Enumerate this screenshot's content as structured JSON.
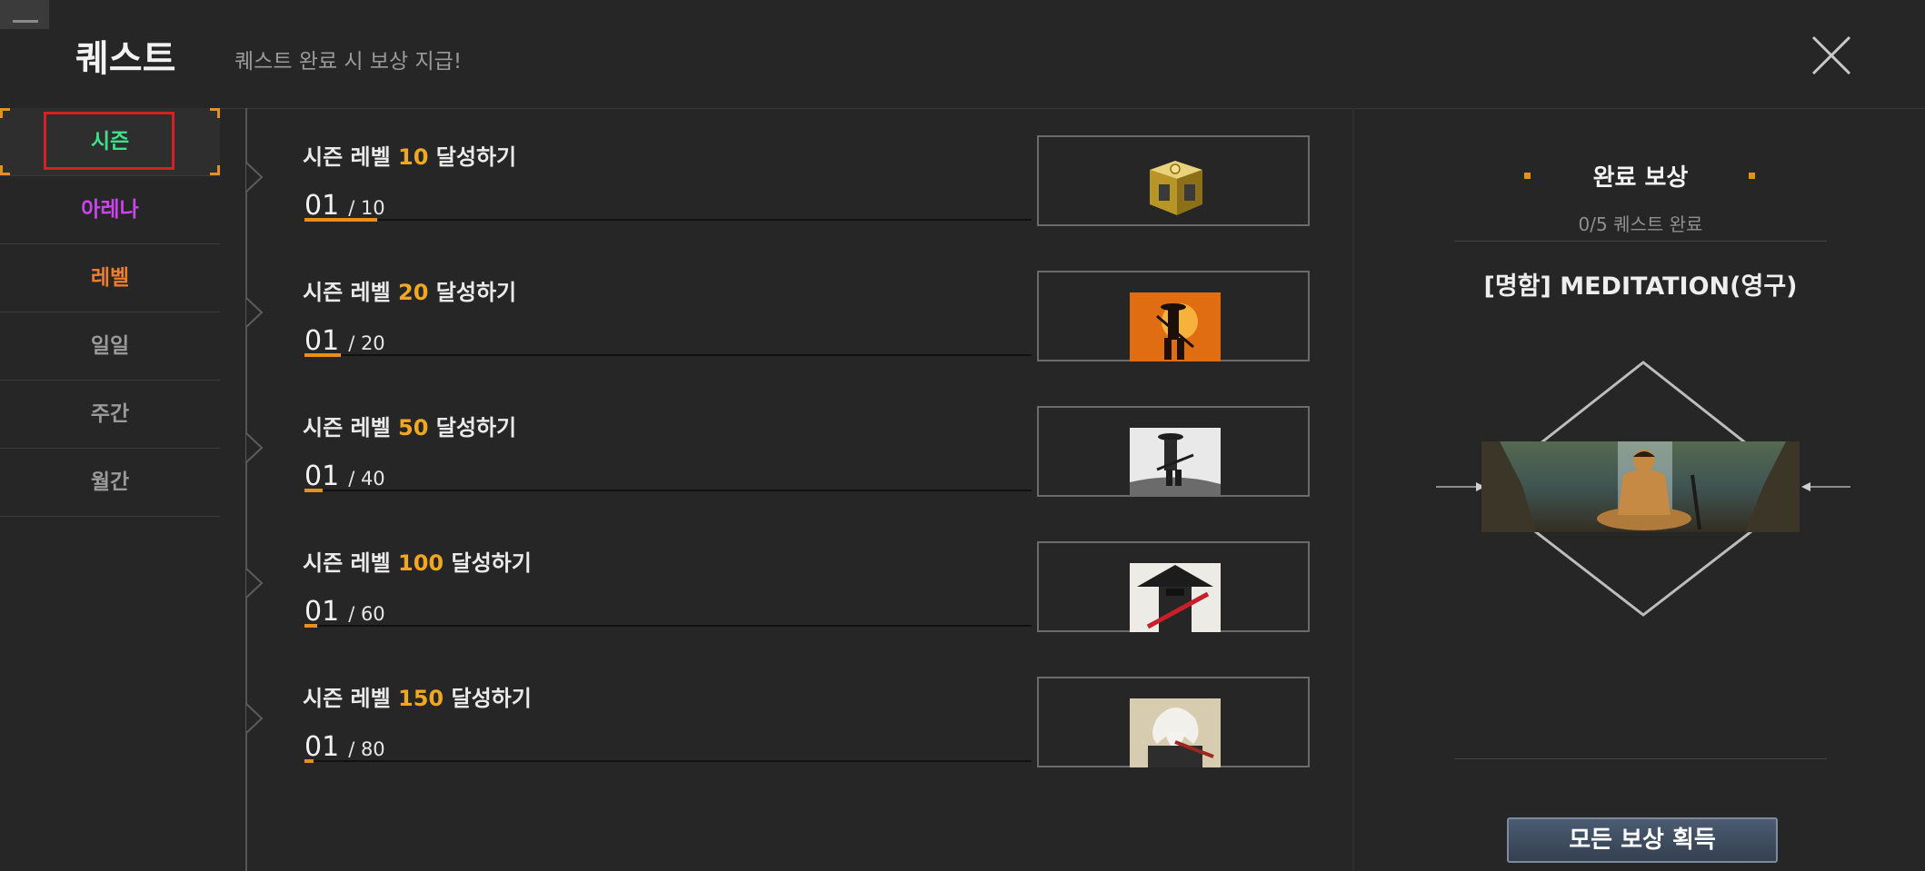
{
  "header": {
    "title": "퀘스트",
    "subtitle": "퀘스트 완료 시 보상 지급!"
  },
  "sidebar": {
    "items": [
      {
        "label": "시즌",
        "color": "#3ee08a",
        "active": true
      },
      {
        "label": "아레나",
        "color": "#cc44ee",
        "active": false
      },
      {
        "label": "레벨",
        "color": "#f07d2a",
        "active": false
      },
      {
        "label": "일일",
        "color": "#9a9a9a",
        "active": false
      },
      {
        "label": "주간",
        "color": "#9a9a9a",
        "active": false
      },
      {
        "label": "월간",
        "color": "#9a9a9a",
        "active": false
      }
    ]
  },
  "quests": [
    {
      "prefix": "시즌 레벨 ",
      "level": "10",
      "suffix": " 달성하기",
      "current": "01",
      "max": "/ 10",
      "progress": 0.1,
      "reward_icon": "gold-chest-icon"
    },
    {
      "prefix": "시즌 레벨 ",
      "level": "20",
      "suffix": " 달성하기",
      "current": "01",
      "max": "/ 20",
      "progress": 0.05,
      "reward_icon": "samurai-sunset-icon"
    },
    {
      "prefix": "시즌 레벨 ",
      "level": "50",
      "suffix": " 달성하기",
      "current": "01",
      "max": "/ 40",
      "progress": 0.025,
      "reward_icon": "samurai-ink-icon"
    },
    {
      "prefix": "시즌 레벨 ",
      "level": "100",
      "suffix": " 달성하기",
      "current": "01",
      "max": "/ 60",
      "progress": 0.017,
      "reward_icon": "ronin-hat-icon"
    },
    {
      "prefix": "시즌 레벨 ",
      "level": "150",
      "suffix": " 달성하기",
      "current": "01",
      "max": "/ 80",
      "progress": 0.0125,
      "reward_icon": "old-sage-icon"
    }
  ],
  "reward_panel": {
    "title": "완료 보상",
    "count": "0/5 퀘스트 완료",
    "item_name": "[명함] MEDITATION(영구)",
    "claim_label": "모든 보상 획득"
  },
  "colors": {
    "accent": "#e8901e",
    "level_number": "#f0a822",
    "selection_border": "#d62027"
  }
}
